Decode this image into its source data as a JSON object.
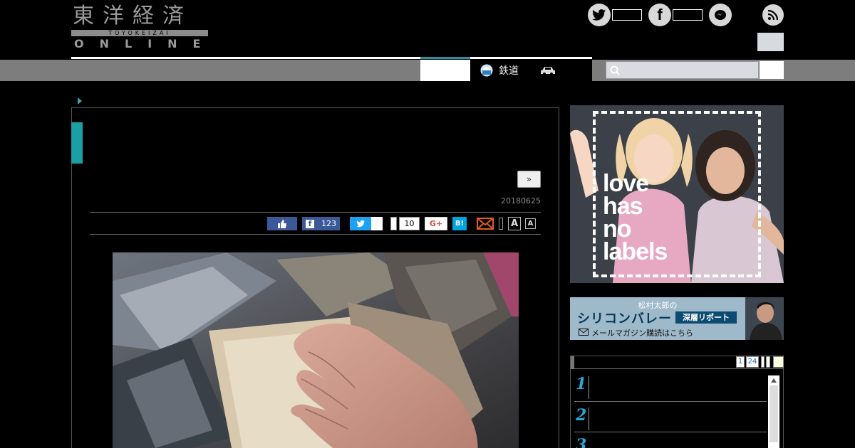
{
  "header": {
    "logo_kanji": "東洋経済",
    "logo_bar": "TOYOKEIZAI",
    "logo_online": "ONLINE"
  },
  "social": {
    "twitter_icon": "twitter-icon",
    "facebook_icon": "facebook-icon",
    "messenger_icon": "messenger-icon",
    "rss_icon": "rss-icon"
  },
  "nav": {
    "rail_label": "鉄道"
  },
  "article": {
    "more_label": "»",
    "date": "20180625",
    "share": {
      "facebook_count": "123",
      "hatena_count": "10",
      "gplus_label": "G+",
      "hatena_label": "B!",
      "font_a": "A"
    }
  },
  "ads": {
    "ad1_text": [
      "love",
      "has",
      "no",
      "labels"
    ],
    "ad2_line1": "松村太郎の",
    "ad2_line2": "シリコンバレー",
    "ad2_line3": "深層リポート",
    "ad2_line4": "メールマガジン購読はこちら"
  },
  "ranking": {
    "pages": [
      "1",
      "24"
    ],
    "numbers": [
      "1",
      "2",
      "3"
    ]
  },
  "colors": {
    "accent": "#1a9fa5",
    "nav_bg": "#7d7d7d",
    "rank_num": "#2aa6d8"
  }
}
